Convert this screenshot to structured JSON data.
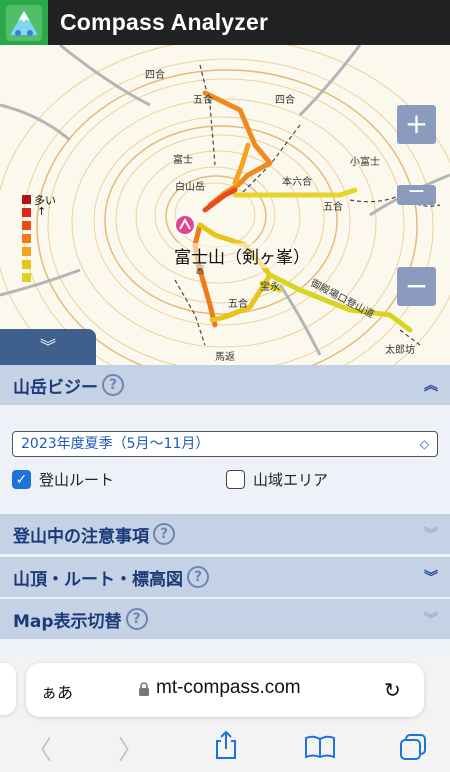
{
  "header": {
    "title": "Compass Analyzer"
  },
  "map": {
    "summit_label": "富士山（剣ヶ峯）",
    "legend_top": "多い",
    "legend_arrow": "↑",
    "legend_colors": [
      "#b5121b",
      "#d8281f",
      "#e94b1d",
      "#f07a1c",
      "#f4a51f",
      "#e7c51a",
      "#d9d321"
    ],
    "place_labels": [
      "四合",
      "五合",
      "五合",
      "四合",
      "小富士",
      "富士",
      "白山岳",
      "本六合",
      "五合",
      "吉田",
      "御殿場口登山道",
      "宝永",
      "五合",
      "太郎坊",
      "馬返",
      "宮",
      "六合"
    ],
    "zoom_in": "+",
    "zoom_mid": "−",
    "zoom_out": "−",
    "collapse_icon": "chevron-double-down-icon"
  },
  "panel": {
    "section1": {
      "title": "山岳ビジー",
      "help": "?",
      "chevron": "︽"
    },
    "season_select": {
      "value": "2023年度夏季（5月～11月）",
      "arrow": "⌃⌄"
    },
    "checkbox_route": {
      "label": "登山ルート",
      "checked": true,
      "mark": "✓"
    },
    "checkbox_area": {
      "label": "山域エリア",
      "checked": false
    },
    "section2": {
      "title": "登山中の注意事項",
      "help": "?",
      "chevron": "︾"
    },
    "section3": {
      "title": "山頂・ルート・標高図",
      "help": "?",
      "chevron": "︾"
    },
    "section4": {
      "title": "Map表示切替",
      "help": "?",
      "chevron": "︾"
    }
  },
  "browser": {
    "aa": "ぁあ",
    "url": "mt-compass.com",
    "reload": "↻",
    "back": "〈",
    "forward": "〉"
  }
}
